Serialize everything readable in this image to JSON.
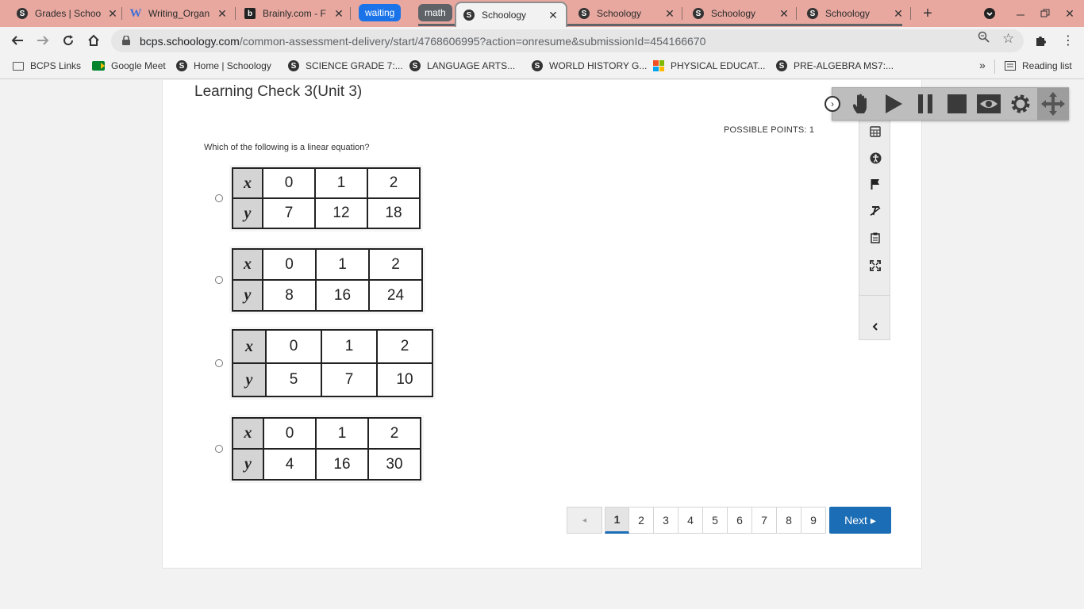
{
  "browser": {
    "tabs": [
      {
        "title": "Grades | Schoo",
        "favicon": "schoology-icon"
      },
      {
        "title": "Writing_Organ",
        "favicon": "word-icon"
      },
      {
        "title": "Brainly.com - F",
        "favicon": "brainly-icon"
      },
      {
        "title": "Schoology",
        "favicon": "schoology-icon",
        "active": true
      },
      {
        "title": "Schoology",
        "favicon": "schoology-icon"
      },
      {
        "title": "Schoology",
        "favicon": "schoology-icon"
      },
      {
        "title": "Schoology",
        "favicon": "schoology-icon"
      }
    ],
    "tab_groups": [
      {
        "label": "waiting",
        "color": "#1a73e8"
      },
      {
        "label": "math",
        "color": "#5f6368"
      }
    ],
    "url_host": "bcps.schoology.com",
    "url_path": "/common-assessment-delivery/start/4768606995?action=onresume&submissionId=454166670",
    "reading_list": "Reading list",
    "chrome_colors": {
      "tabstrip": "#e8a8a0",
      "toolbar": "#f2f2f2"
    }
  },
  "bookmarks": [
    {
      "label": "BCPS Links",
      "icon": "folder-icon"
    },
    {
      "label": "Google Meet",
      "icon": "google-meet-icon"
    },
    {
      "label": "Home | Schoology",
      "icon": "schoology-icon"
    },
    {
      "label": "SCIENCE GRADE 7:...",
      "icon": "schoology-icon"
    },
    {
      "label": "LANGUAGE ARTS...",
      "icon": "schoology-icon"
    },
    {
      "label": "WORLD HISTORY G...",
      "icon": "schoology-icon"
    },
    {
      "label": "PHYSICAL EDUCAT...",
      "icon": "microsoft-icon"
    },
    {
      "label": "PRE-ALGEBRA MS7:...",
      "icon": "schoology-icon"
    }
  ],
  "assessment": {
    "title": "Learning Check 3(Unit 3)",
    "possible_points": "POSSIBLE POINTS: 1",
    "question": "Which of the following is  a linear equation?",
    "choices": [
      {
        "x_label": "x",
        "y_label": "y",
        "x": [
          "0",
          "1",
          "2"
        ],
        "y": [
          "7",
          "12",
          "18"
        ]
      },
      {
        "x_label": "x",
        "y_label": "y",
        "x": [
          "0",
          "1",
          "2"
        ],
        "y": [
          "8",
          "16",
          "24"
        ]
      },
      {
        "x_label": "x",
        "y_label": "y",
        "x": [
          "0",
          "1",
          "2"
        ],
        "y": [
          "5",
          "7",
          "10"
        ]
      },
      {
        "x_label": "x",
        "y_label": "y",
        "x": [
          "0",
          "1",
          "2"
        ],
        "y": [
          "4",
          "16",
          "30"
        ]
      }
    ],
    "pager": {
      "prev_symbol": "◂",
      "pages": [
        "1",
        "2",
        "3",
        "4",
        "5",
        "6",
        "7",
        "8",
        "9"
      ],
      "current": "1",
      "next_label": "Next ▸"
    },
    "accent_color": "#1b6db5"
  },
  "side_tools": [
    "calculator-icon",
    "accessibility-icon",
    "flag-icon",
    "clear-format-icon",
    "notepad-icon",
    "fullscreen-icon",
    "collapse-left-icon"
  ],
  "readwrite_toolbar": [
    "collapse-icon",
    "hand-pointer-icon",
    "play-icon",
    "pause-icon",
    "stop-icon",
    "screen-mask-icon",
    "settings-icon",
    "move-icon"
  ]
}
